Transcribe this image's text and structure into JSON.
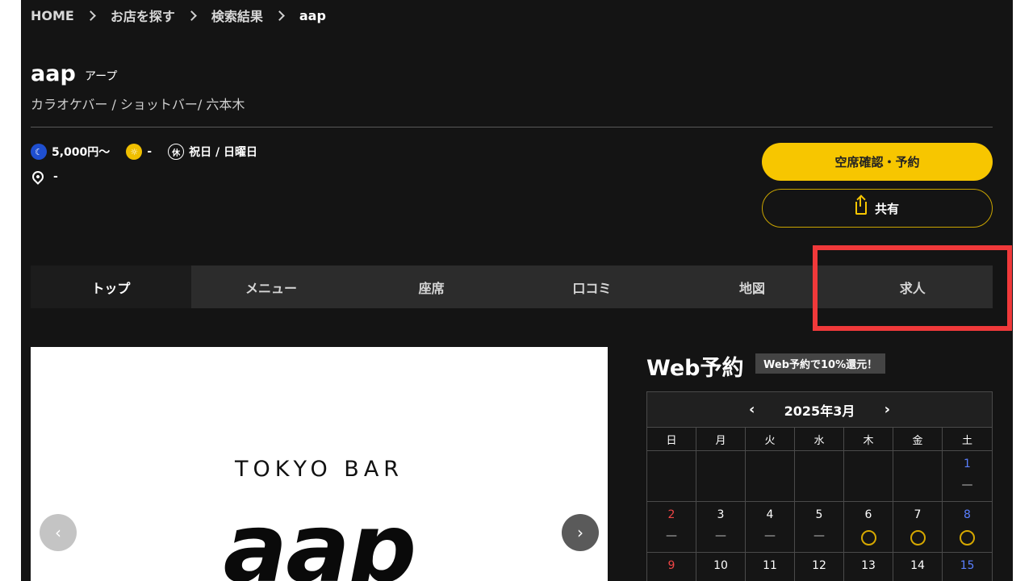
{
  "breadcrumb": [
    "HOME",
    "お店を探す",
    "検索結果",
    "aap"
  ],
  "shop": {
    "name": "aap",
    "kana": "アープ",
    "category": "カラオケバー / ショットバー/ 六本木",
    "night_price": "5,000円〜",
    "day_price": "-",
    "closed_label": "休",
    "closed_days": "祝日 / 日曜日",
    "location": "-"
  },
  "buttons": {
    "reserve": "空席確認・予約",
    "share": "共有"
  },
  "tabs": [
    "トップ",
    "メニュー",
    "座席",
    "口コミ",
    "地図",
    "求人"
  ],
  "hero": {
    "subtitle": "TOKYO BAR",
    "logo": "aap",
    "prev": "‹",
    "next": "›"
  },
  "web_reservation": {
    "title": "Web予約",
    "badge": "Web予約で10%還元！"
  },
  "calendar": {
    "prev": "‹",
    "next": "›",
    "month": "2025年3月",
    "weekdays": [
      "日",
      "月",
      "火",
      "水",
      "木",
      "金",
      "土"
    ],
    "rows": [
      [
        {
          "day": "",
          "mark": ""
        },
        {
          "day": "",
          "mark": ""
        },
        {
          "day": "",
          "mark": ""
        },
        {
          "day": "",
          "mark": ""
        },
        {
          "day": "",
          "mark": ""
        },
        {
          "day": "",
          "mark": ""
        },
        {
          "day": "1",
          "mark": "—"
        }
      ],
      [
        {
          "day": "2",
          "mark": "—"
        },
        {
          "day": "3",
          "mark": "—"
        },
        {
          "day": "4",
          "mark": "—"
        },
        {
          "day": "5",
          "mark": "—"
        },
        {
          "day": "6",
          "mark": "○"
        },
        {
          "day": "7",
          "mark": "○"
        },
        {
          "day": "8",
          "mark": "○"
        }
      ],
      [
        {
          "day": "9",
          "mark": "○"
        },
        {
          "day": "10",
          "mark": "○"
        },
        {
          "day": "11",
          "mark": "○"
        },
        {
          "day": "12",
          "mark": "○"
        },
        {
          "day": "13",
          "mark": "○"
        },
        {
          "day": "14",
          "mark": "○"
        },
        {
          "day": "15",
          "mark": "○"
        }
      ]
    ]
  },
  "colors": {
    "accent": "#f7c600",
    "highlight": "#f0393a",
    "sunday": "#f04545",
    "saturday": "#5a7fff"
  }
}
